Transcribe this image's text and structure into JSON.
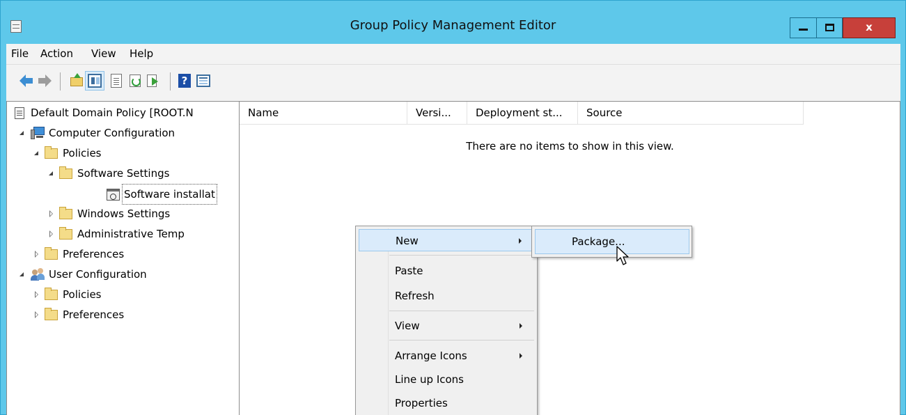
{
  "window": {
    "title": "Group Policy Management Editor",
    "controls": {
      "close_label": "x"
    }
  },
  "menubar": {
    "items": [
      "File",
      "Action",
      "View",
      "Help"
    ]
  },
  "toolbar": {
    "buttons": [
      "back-icon",
      "forward-icon",
      "up-folder-icon",
      "show-hide-tree-icon",
      "properties-icon",
      "refresh-icon",
      "export-list-icon",
      "help-icon",
      "show-hide-action-pane-icon"
    ],
    "help_glyph": "?"
  },
  "tree": {
    "root": "Default Domain Policy [ROOT.N",
    "computer_configuration": "Computer Configuration",
    "policies": "Policies",
    "software_settings": "Software Settings",
    "software_installation": "Software installat",
    "windows_settings": "Windows Settings",
    "administrative_templates": "Administrative Temp",
    "preferences": "Preferences",
    "user_configuration": "User Configuration",
    "user_policies": "Policies",
    "user_preferences": "Preferences"
  },
  "list": {
    "columns": [
      "Name",
      "Versi...",
      "Deployment st...",
      "Source"
    ],
    "empty_message": "There are no items to show in this view."
  },
  "context_menu": {
    "items": [
      {
        "label": "New",
        "has_submenu": true,
        "highlighted": true
      },
      {
        "label": "Paste",
        "has_submenu": false
      },
      {
        "label": "Refresh",
        "has_submenu": false
      },
      {
        "label": "View",
        "has_submenu": true
      },
      {
        "label": "Arrange Icons",
        "has_submenu": true
      },
      {
        "label": "Line up Icons",
        "has_submenu": false
      },
      {
        "label": "Properties",
        "has_submenu": false
      }
    ]
  },
  "submenu": {
    "items": [
      {
        "label": "Package...",
        "highlighted": true
      }
    ]
  },
  "colors": {
    "title_bar": "#5ec8ea",
    "close_button": "#c7403a",
    "highlight": "#daebfb",
    "highlight_border": "#9cc8ed"
  }
}
